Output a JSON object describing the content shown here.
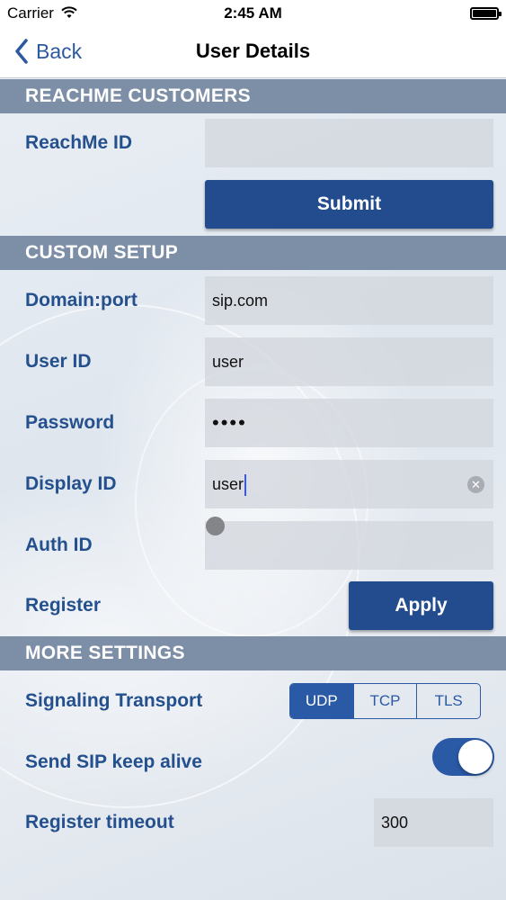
{
  "status_bar": {
    "carrier": "Carrier",
    "time": "2:45 AM"
  },
  "nav": {
    "back_label": "Back",
    "title": "User Details"
  },
  "sections": {
    "reachme": {
      "header": "REACHME CUSTOMERS",
      "reachme_id_label": "ReachMe ID",
      "reachme_id_value": "",
      "submit_label": "Submit"
    },
    "custom": {
      "header": "CUSTOM SETUP",
      "domain_label": "Domain:port",
      "domain_value": "sip.com",
      "user_id_label": "User ID",
      "user_id_value": "user",
      "password_label": "Password",
      "password_value": "••••",
      "display_id_label": "Display ID",
      "display_id_value": "user",
      "auth_id_label": "Auth ID",
      "auth_id_value": "",
      "register_label": "Register",
      "apply_label": "Apply"
    },
    "more": {
      "header": "MORE SETTINGS",
      "transport_label": "Signaling Transport",
      "transport_options": [
        "UDP",
        "TCP",
        "TLS"
      ],
      "transport_selected": "UDP",
      "keepalive_label": "Send SIP keep alive",
      "keepalive_on": true,
      "timeout_label": "Register timeout",
      "timeout_value": "300"
    }
  },
  "colors": {
    "accent": "#2a59a6",
    "label": "#24508e",
    "section_header": "#7d8ea7",
    "button": "#234c8f"
  }
}
